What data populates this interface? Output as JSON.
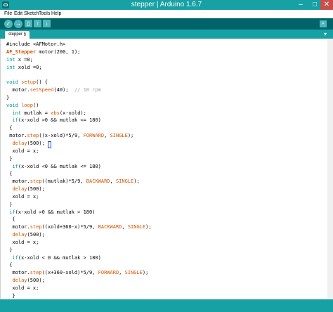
{
  "window": {
    "title": "stepper | Arduino 1.6.7",
    "minimize": "–",
    "maximize": "□",
    "close": "✕"
  },
  "menu": [
    {
      "label": "File"
    },
    {
      "label": "Edit"
    },
    {
      "label": "Sketch"
    },
    {
      "label": "Tools"
    },
    {
      "label": "Help"
    }
  ],
  "toolbar": {
    "verify": "✓",
    "upload": "→",
    "new": "▯",
    "open": "↑",
    "save": "↓",
    "serial_monitor": "⌕"
  },
  "tab": {
    "label": "stepper §",
    "menu_arrow": "▾"
  },
  "colors": {
    "teal": "#17a1a5",
    "dark_teal": "#006468",
    "keyword": "#00979c",
    "function": "#d35400",
    "comment": "#95a5a6"
  },
  "code_lines": [
    [
      [
        "",
        "#include <AFMotor.h>"
      ]
    ],
    [
      [
        "cl",
        "AF_Stepper"
      ],
      [
        "",
        " motor(200, 1);"
      ]
    ],
    [
      [
        "kw",
        "int"
      ],
      [
        "",
        " x =0;"
      ]
    ],
    [
      [
        "kw",
        "int"
      ],
      [
        "",
        " xold =0;"
      ]
    ],
    [
      [
        "",
        ""
      ]
    ],
    [
      [
        "kw",
        "void"
      ],
      [
        "",
        " "
      ],
      [
        "fn",
        "setup"
      ],
      [
        "",
        "() {"
      ]
    ],
    [
      [
        "",
        "  motor."
      ],
      [
        "fn",
        "setSpeed"
      ],
      [
        "",
        "(40);  "
      ],
      [
        "cm",
        "// 10 rpm"
      ]
    ],
    [
      [
        "",
        "}"
      ]
    ],
    [
      [
        "kw",
        "void"
      ],
      [
        "",
        " "
      ],
      [
        "fn",
        "loop"
      ],
      [
        "",
        "() "
      ]
    ],
    [
      [
        "",
        "  "
      ],
      [
        "kw",
        "int"
      ],
      [
        "",
        " mutlak = "
      ],
      [
        "fn",
        "abs"
      ],
      [
        "",
        "(x-xold);"
      ]
    ],
    [
      [
        "",
        "  "
      ],
      [
        "kw",
        "if"
      ],
      [
        "",
        "(x-xold >0 && mutlak <= 180)"
      ]
    ],
    [
      [
        "",
        " {"
      ]
    ],
    [
      [
        "",
        " motor."
      ],
      [
        "fn",
        "step"
      ],
      [
        "",
        "((x-xold)*5/9, "
      ],
      [
        "fn",
        "FORWARD"
      ],
      [
        "",
        ", "
      ],
      [
        "fn",
        "SINGLE"
      ],
      [
        "",
        ");"
      ]
    ],
    [
      [
        "",
        "  "
      ],
      [
        "fn",
        "delay"
      ],
      [
        "",
        "(500);"
      ]
    ],
    [
      [
        "",
        "  xold = x;"
      ]
    ],
    [
      [
        "",
        " }"
      ]
    ],
    [
      [
        "",
        "  "
      ],
      [
        "kw",
        "if"
      ],
      [
        "",
        "(x-xold <0 && mutlak <= 180)"
      ]
    ],
    [
      [
        "",
        " {"
      ]
    ],
    [
      [
        "",
        "  motor."
      ],
      [
        "fn",
        "step"
      ],
      [
        "",
        "((mutlak)*5/9, "
      ],
      [
        "fn",
        "BACKWARD"
      ],
      [
        "",
        ", "
      ],
      [
        "fn",
        "SINGLE"
      ],
      [
        "",
        ");"
      ]
    ],
    [
      [
        "",
        "  "
      ],
      [
        "fn",
        "delay"
      ],
      [
        "",
        "(500);"
      ]
    ],
    [
      [
        "",
        "  xold = x;"
      ]
    ],
    [
      [
        "",
        " }"
      ]
    ],
    [
      [
        "",
        " "
      ],
      [
        "kw",
        "if"
      ],
      [
        "",
        "(x-xold >0 && mutlak > 180)"
      ]
    ],
    [
      [
        "",
        "  {"
      ]
    ],
    [
      [
        "",
        "  motor."
      ],
      [
        "fn",
        "step"
      ],
      [
        "",
        "((xold+360-x)*5/9, "
      ],
      [
        "fn",
        "BACKWARD"
      ],
      [
        "",
        ", "
      ],
      [
        "fn",
        "SINGLE"
      ],
      [
        "",
        ");"
      ]
    ],
    [
      [
        "",
        "  "
      ],
      [
        "fn",
        "delay"
      ],
      [
        "",
        "(500);"
      ]
    ],
    [
      [
        "",
        "  xold = x;"
      ]
    ],
    [
      [
        "",
        " }"
      ]
    ],
    [
      [
        "",
        "  "
      ],
      [
        "kw",
        "if"
      ],
      [
        "",
        "(x-xold < 0 && mutlak > 180)"
      ]
    ],
    [
      [
        "",
        " {"
      ]
    ],
    [
      [
        "",
        "  motor."
      ],
      [
        "fn",
        "step"
      ],
      [
        "",
        "((x+360-xold)*5/9, "
      ],
      [
        "fn",
        "FORWARD"
      ],
      [
        "",
        ", "
      ],
      [
        "fn",
        "SINGLE"
      ],
      [
        "",
        ");"
      ]
    ],
    [
      [
        "",
        "  "
      ],
      [
        "fn",
        "delay"
      ],
      [
        "",
        "(500);"
      ]
    ],
    [
      [
        "",
        "  xold = x;"
      ]
    ],
    [
      [
        "",
        "  }"
      ]
    ]
  ]
}
